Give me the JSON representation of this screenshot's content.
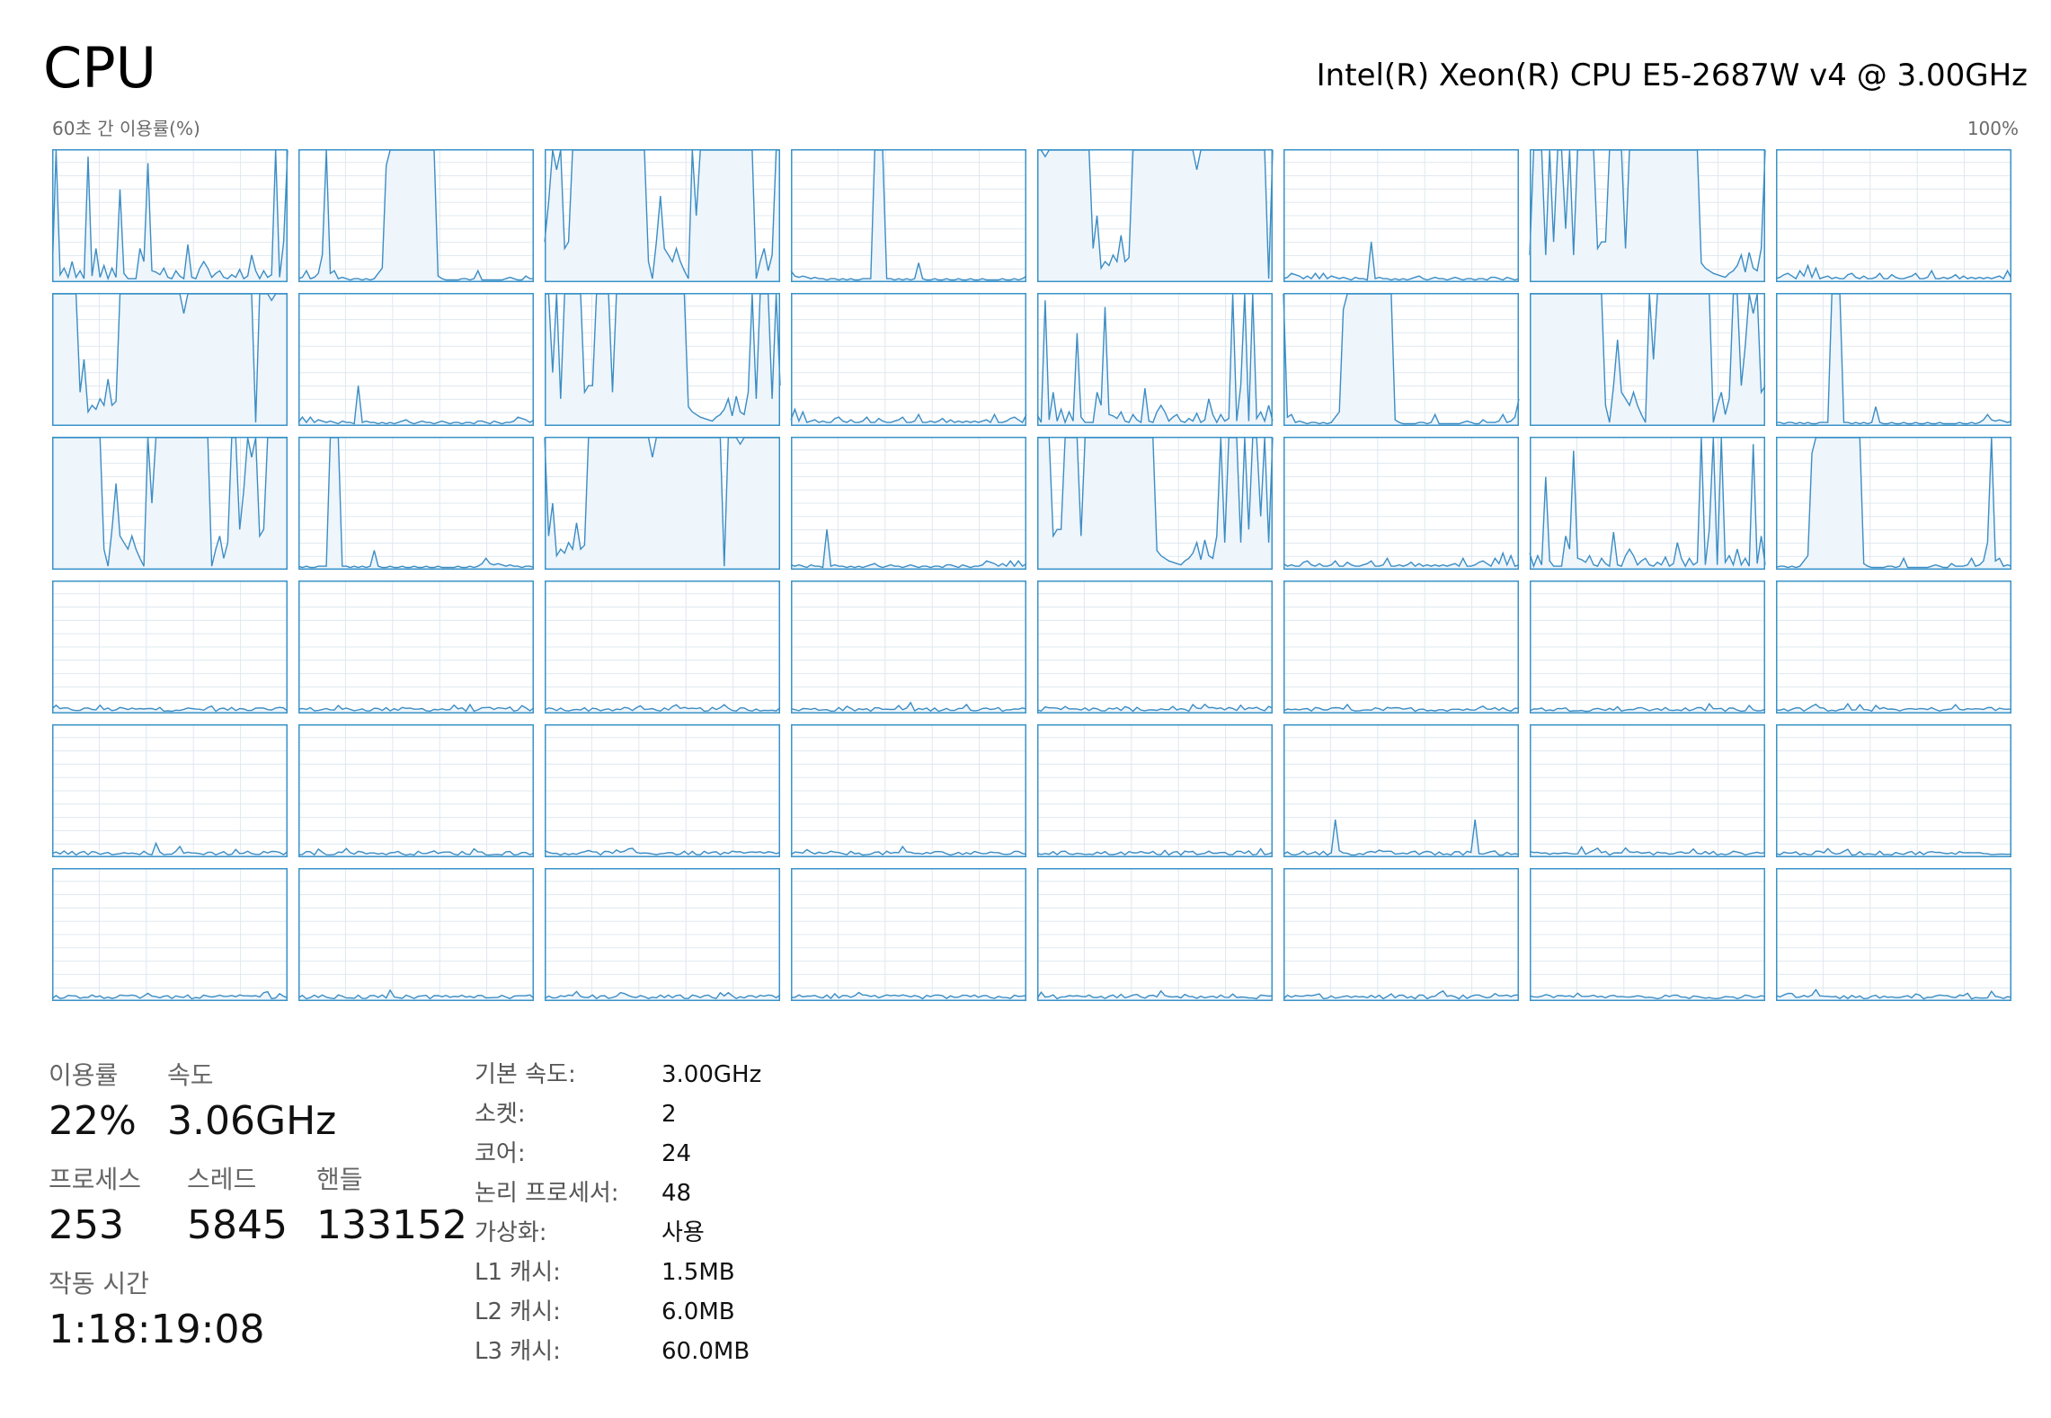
{
  "header": {
    "title": "CPU",
    "model": "Intel(R) Xeon(R) CPU E5-2687W v4 @ 3.00GHz",
    "axis_caption": "60초 간 이용률(%)",
    "axis_max": "100%"
  },
  "colors": {
    "graph_line": "#3c8dc4",
    "graph_fill": "#eef5fb",
    "graph_border": "#3a93c8",
    "grid_line": "#dfe8ef"
  },
  "stats": {
    "utilization": {
      "label": "이용률",
      "value": "22%"
    },
    "speed": {
      "label": "속도",
      "value": "3.06GHz"
    },
    "processes": {
      "label": "프로세스",
      "value": "253"
    },
    "threads": {
      "label": "스레드",
      "value": "5845"
    },
    "handles": {
      "label": "핸들",
      "value": "133152"
    },
    "uptime": {
      "label": "작동 시간",
      "value": "1:18:19:08"
    }
  },
  "specs": [
    {
      "key": "기본 속도:",
      "value": "3.00GHz"
    },
    {
      "key": "소켓:",
      "value": "2"
    },
    {
      "key": "코어:",
      "value": "24"
    },
    {
      "key": "논리 프로세서:",
      "value": "48"
    },
    {
      "key": "가상화:",
      "value": "사용"
    },
    {
      "key": "L1 캐시:",
      "value": "1.5MB"
    },
    {
      "key": "L2 캐시:",
      "value": "6.0MB"
    },
    {
      "key": "L3 캐시:",
      "value": "60.0MB"
    }
  ],
  "cores": [
    [
      3,
      100,
      5,
      10,
      3,
      15,
      3,
      8,
      2,
      95,
      4,
      25,
      3,
      12,
      2,
      10,
      3,
      70,
      6,
      2,
      2,
      2,
      25,
      15,
      90,
      8,
      7,
      5,
      10,
      3,
      2,
      8,
      4,
      2,
      28,
      3,
      2,
      10,
      15,
      10,
      3,
      6,
      8,
      3,
      2,
      5,
      3,
      9,
      2,
      4,
      20,
      8,
      2,
      8,
      3,
      5,
      100,
      3,
      30,
      100
    ],
    [
      2,
      3,
      8,
      2,
      3,
      6,
      20,
      100,
      6,
      8,
      2,
      3,
      2,
      1,
      2,
      2,
      1,
      2,
      1,
      2,
      6,
      10,
      88,
      100,
      100,
      100,
      100,
      100,
      100,
      100,
      100,
      100,
      100,
      100,
      100,
      4,
      2,
      1,
      1,
      1,
      1,
      2,
      2,
      1,
      2,
      8,
      1,
      1,
      1,
      1,
      1,
      1,
      2,
      3,
      2,
      1,
      1,
      4,
      2,
      2
    ],
    [
      30,
      60,
      100,
      85,
      100,
      25,
      30,
      100,
      100,
      100,
      100,
      100,
      100,
      100,
      100,
      100,
      100,
      100,
      100,
      100,
      100,
      100,
      100,
      100,
      100,
      100,
      15,
      2,
      30,
      65,
      25,
      20,
      15,
      25,
      15,
      8,
      2,
      100,
      50,
      100,
      100,
      100,
      100,
      100,
      100,
      100,
      100,
      100,
      100,
      100,
      100,
      100,
      100,
      2,
      15,
      25,
      8,
      20,
      100,
      100
    ],
    [
      8,
      4,
      3,
      4,
      3,
      2,
      3,
      2,
      2,
      1,
      2,
      2,
      1,
      2,
      1,
      2,
      1,
      1,
      2,
      2,
      2,
      100,
      100,
      100,
      2,
      2,
      1,
      2,
      1,
      2,
      1,
      2,
      14,
      2,
      1,
      1,
      2,
      1,
      1,
      2,
      1,
      1,
      2,
      1,
      1,
      2,
      1,
      1,
      2,
      1,
      1,
      1,
      1,
      2,
      1,
      1,
      2,
      1,
      2,
      4
    ],
    [
      100,
      100,
      95,
      100,
      100,
      100,
      100,
      100,
      100,
      100,
      100,
      100,
      100,
      100,
      25,
      50,
      10,
      15,
      12,
      20,
      15,
      35,
      15,
      18,
      100,
      100,
      100,
      100,
      100,
      100,
      100,
      100,
      100,
      100,
      100,
      100,
      100,
      100,
      100,
      100,
      85,
      100,
      100,
      100,
      100,
      100,
      100,
      100,
      100,
      100,
      100,
      100,
      100,
      100,
      100,
      100,
      100,
      100,
      2,
      100
    ],
    [
      2,
      3,
      6,
      5,
      4,
      2,
      4,
      2,
      6,
      2,
      6,
      2,
      4,
      3,
      2,
      3,
      2,
      1,
      3,
      2,
      2,
      1,
      30,
      2,
      3,
      2,
      2,
      1,
      2,
      1,
      2,
      1,
      2,
      3,
      4,
      2,
      1,
      2,
      3,
      2,
      2,
      1,
      2,
      3,
      2,
      1,
      2,
      2,
      1,
      2,
      2,
      1,
      3,
      3,
      2,
      1,
      3,
      2,
      1,
      2
    ],
    [
      20,
      100,
      100,
      100,
      20,
      100,
      30,
      100,
      100,
      40,
      100,
      20,
      100,
      100,
      100,
      100,
      100,
      25,
      30,
      30,
      100,
      100,
      100,
      100,
      25,
      100,
      100,
      100,
      100,
      100,
      100,
      100,
      100,
      100,
      100,
      100,
      100,
      100,
      100,
      100,
      100,
      100,
      100,
      14,
      10,
      8,
      6,
      5,
      4,
      3,
      6,
      8,
      12,
      20,
      7,
      22,
      10,
      8,
      25,
      100
    ],
    [
      2,
      3,
      5,
      6,
      4,
      2,
      8,
      4,
      12,
      3,
      10,
      2,
      3,
      4,
      2,
      3,
      2,
      2,
      5,
      6,
      3,
      2,
      4,
      2,
      2,
      3,
      6,
      2,
      2,
      5,
      3,
      2,
      2,
      3,
      4,
      6,
      2,
      2,
      3,
      8,
      2,
      2,
      3,
      2,
      3,
      5,
      2,
      4,
      2,
      3,
      2,
      3,
      2,
      3,
      2,
      3,
      4,
      2,
      8,
      2
    ]
  ]
}
